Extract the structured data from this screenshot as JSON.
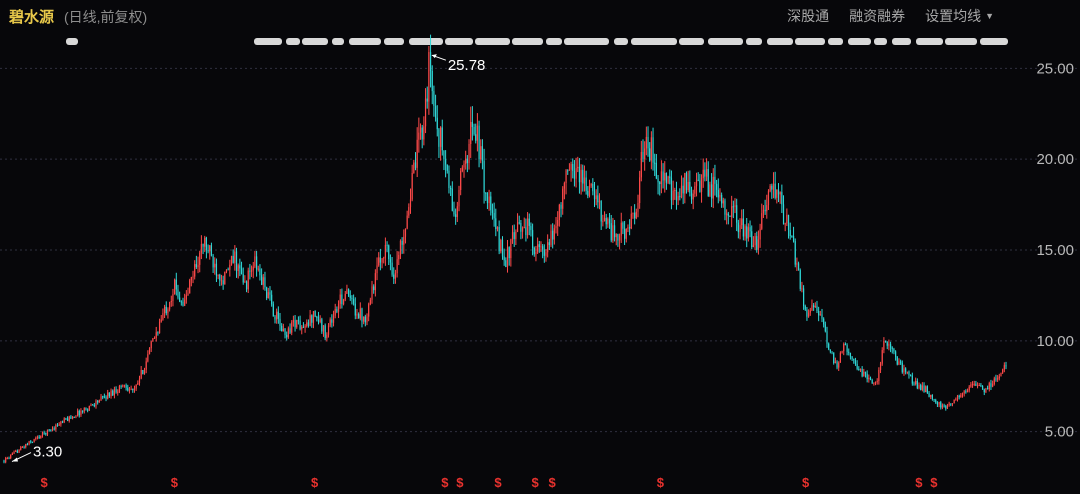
{
  "header": {
    "stock_name": "碧水源",
    "chart_desc": "(日线,前复权)",
    "toolbar": {
      "hk_connect_label": "深股通",
      "margin_label": "融资融券",
      "ma_settings_label": "设置均线"
    }
  },
  "colors": {
    "background": "#07070a",
    "up_candle": "#ff4a4a",
    "down_candle": "#2fd8d8",
    "grid": "#2f3040",
    "stock_name": "#e8c84a",
    "marker": "#e8322e",
    "event_strip": "#d8d8d8"
  },
  "chart_data": {
    "type": "candlestick",
    "title": "碧水源",
    "subtitle": "(日线,前复权)",
    "y_ticks": [
      "5.00",
      "10.00",
      "15.00",
      "20.00",
      "25.00"
    ],
    "ylim": [
      3.0,
      27.0
    ],
    "grid": "horizontal-dashed",
    "annotations": [
      {
        "label": "25.78",
        "value": 25.78,
        "type": "high",
        "position_frac": 0.425
      },
      {
        "label": "3.30",
        "value": 3.3,
        "type": "low",
        "position_frac": 0.005
      }
    ],
    "price_path": [
      [
        0.0,
        3.4
      ],
      [
        0.02,
        4.2
      ],
      [
        0.04,
        4.9
      ],
      [
        0.06,
        5.6
      ],
      [
        0.08,
        6.2
      ],
      [
        0.1,
        6.9
      ],
      [
        0.12,
        7.6
      ],
      [
        0.13,
        7.2
      ],
      [
        0.14,
        8.6
      ],
      [
        0.15,
        10.2
      ],
      [
        0.16,
        11.6
      ],
      [
        0.17,
        13.0
      ],
      [
        0.18,
        12.0
      ],
      [
        0.19,
        14.0
      ],
      [
        0.2,
        15.4
      ],
      [
        0.21,
        14.2
      ],
      [
        0.22,
        13.4
      ],
      [
        0.23,
        14.6
      ],
      [
        0.24,
        13.0
      ],
      [
        0.25,
        14.3
      ],
      [
        0.26,
        13.0
      ],
      [
        0.27,
        11.5
      ],
      [
        0.28,
        10.3
      ],
      [
        0.29,
        11.1
      ],
      [
        0.3,
        10.6
      ],
      [
        0.31,
        11.6
      ],
      [
        0.32,
        10.4
      ],
      [
        0.33,
        11.5
      ],
      [
        0.34,
        12.7
      ],
      [
        0.35,
        11.8
      ],
      [
        0.36,
        11.2
      ],
      [
        0.37,
        13.4
      ],
      [
        0.38,
        15.3
      ],
      [
        0.39,
        13.6
      ],
      [
        0.4,
        16.4
      ],
      [
        0.41,
        19.5
      ],
      [
        0.42,
        22.8
      ],
      [
        0.425,
        25.3
      ],
      [
        0.43,
        22.5
      ],
      [
        0.44,
        19.8
      ],
      [
        0.45,
        16.6
      ],
      [
        0.46,
        20.2
      ],
      [
        0.47,
        22.1
      ],
      [
        0.48,
        18.4
      ],
      [
        0.49,
        16.2
      ],
      [
        0.5,
        14.4
      ],
      [
        0.51,
        15.8
      ],
      [
        0.52,
        16.5
      ],
      [
        0.53,
        15.2
      ],
      [
        0.54,
        14.6
      ],
      [
        0.55,
        16.2
      ],
      [
        0.56,
        18.8
      ],
      [
        0.57,
        19.6
      ],
      [
        0.58,
        18.7
      ],
      [
        0.59,
        17.8
      ],
      [
        0.6,
        16.8
      ],
      [
        0.61,
        15.6
      ],
      [
        0.62,
        16.2
      ],
      [
        0.63,
        16.6
      ],
      [
        0.64,
        21.6
      ],
      [
        0.65,
        19.6
      ],
      [
        0.66,
        18.8
      ],
      [
        0.67,
        17.6
      ],
      [
        0.68,
        18.6
      ],
      [
        0.69,
        18.2
      ],
      [
        0.7,
        18.9
      ],
      [
        0.71,
        18.2
      ],
      [
        0.72,
        17.6
      ],
      [
        0.73,
        16.8
      ],
      [
        0.74,
        15.9
      ],
      [
        0.75,
        15.2
      ],
      [
        0.76,
        17.6
      ],
      [
        0.77,
        18.4
      ],
      [
        0.78,
        16.6
      ],
      [
        0.79,
        14.6
      ],
      [
        0.8,
        11.5
      ],
      [
        0.81,
        12.2
      ],
      [
        0.82,
        10.2
      ],
      [
        0.83,
        8.6
      ],
      [
        0.84,
        9.8
      ],
      [
        0.85,
        8.7
      ],
      [
        0.86,
        8.0
      ],
      [
        0.87,
        7.6
      ],
      [
        0.88,
        10.2
      ],
      [
        0.89,
        9.0
      ],
      [
        0.9,
        8.2
      ],
      [
        0.91,
        7.6
      ],
      [
        0.92,
        7.3
      ],
      [
        0.93,
        6.6
      ],
      [
        0.94,
        6.2
      ],
      [
        0.95,
        6.9
      ],
      [
        0.96,
        7.3
      ],
      [
        0.97,
        7.6
      ],
      [
        0.98,
        7.3
      ],
      [
        0.99,
        8.0
      ],
      [
        1.0,
        8.6
      ]
    ],
    "margin_markers": [
      {
        "label": "$",
        "position_frac": 0.04
      },
      {
        "label": "$",
        "position_frac": 0.17
      },
      {
        "label": "$",
        "position_frac": 0.31
      },
      {
        "label": "$",
        "position_frac": 0.44
      },
      {
        "label": "$",
        "position_frac": 0.455
      },
      {
        "label": "$",
        "position_frac": 0.493
      },
      {
        "label": "$",
        "position_frac": 0.53
      },
      {
        "label": "$",
        "position_frac": 0.547
      },
      {
        "label": "$",
        "position_frac": 0.655
      },
      {
        "label": "$",
        "position_frac": 0.8
      },
      {
        "label": "$",
        "position_frac": 0.913
      },
      {
        "label": "$",
        "position_frac": 0.928
      }
    ]
  }
}
